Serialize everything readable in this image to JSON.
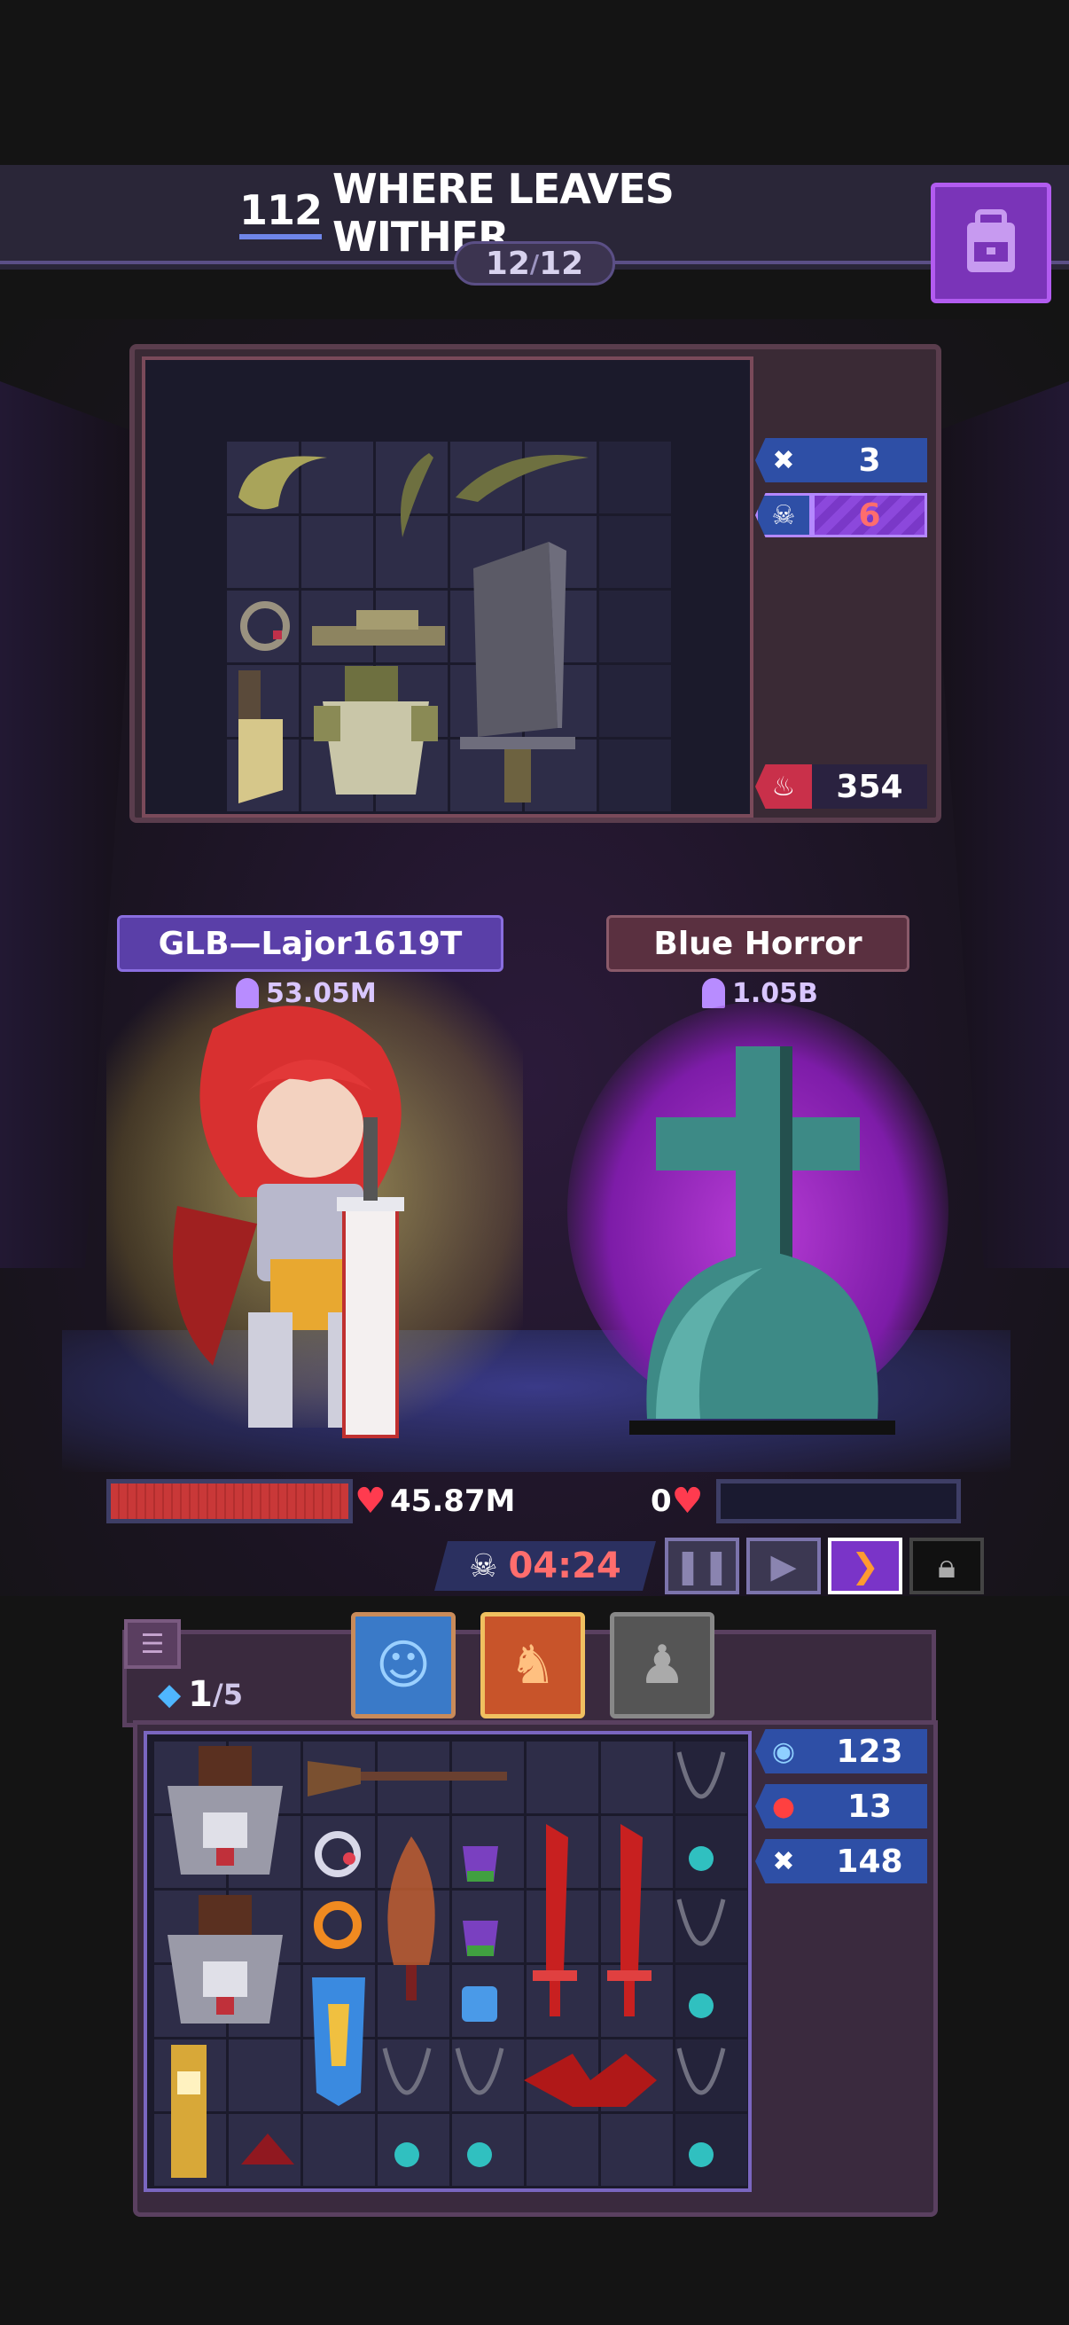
{
  "header": {
    "stage_number": "112",
    "stage_name": "WHERE LEAVES WITHER",
    "wave_current": "12",
    "wave_separator": "/",
    "wave_total": "12",
    "bag_icon": "backpack-icon"
  },
  "enemy_stats": [
    {
      "icon": "crossed-bones-icon",
      "value": "3",
      "icon_color": "#2e4fa6",
      "value_color": "#2e4fa6"
    },
    {
      "icon": "skull-icon",
      "value": "6",
      "icon_color": "#2e4fa6",
      "value_color": "#7a38c8"
    },
    {
      "icon": "demon-icon",
      "value": "354",
      "icon_color": "#c9304a",
      "value_color": "#2a2240"
    }
  ],
  "player": {
    "name": "GLB—Lajor1619T",
    "power": "53.05M",
    "hp": "45.87M",
    "hp_fill": 1.0
  },
  "enemy": {
    "name": "Blue Horror",
    "power": "1.05B",
    "hp": "0",
    "hp_fill": 0.0
  },
  "battle": {
    "timer": "04:24",
    "controls": [
      "pause-icon",
      "play-icon",
      "fast-forward-icon",
      "lock-icon"
    ]
  },
  "bag": {
    "mercenary_count": "1",
    "mercenary_max": "/5",
    "mercenaries": [
      "blue-slime-mercenary",
      "orange-dragon-mercenary",
      "locked-gray-mercenary"
    ]
  },
  "player_stats": [
    {
      "icon": "shield-orb-icon",
      "value": "123",
      "icon_color": "#4a9fd8"
    },
    {
      "icon": "red-mask-icon",
      "value": "13",
      "icon_color": "#d33"
    },
    {
      "icon": "crossed-bones-icon",
      "value": "148",
      "icon_color": "#2e4fa6"
    }
  ]
}
